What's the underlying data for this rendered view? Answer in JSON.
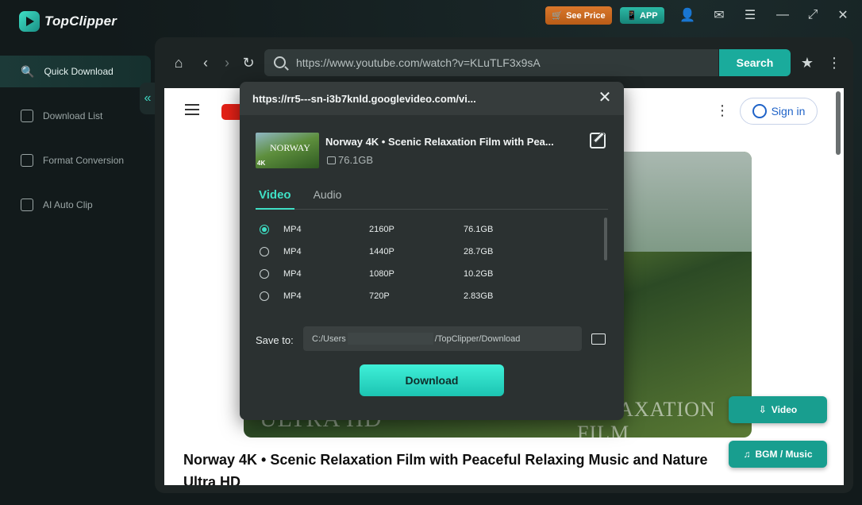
{
  "app": {
    "name": "TopClipper",
    "see_price": "See Price",
    "app_label": "APP"
  },
  "sidebar": {
    "items": [
      {
        "label": "Quick Download",
        "icon": "search-icon"
      },
      {
        "label": "Download List",
        "icon": "download-list-icon"
      },
      {
        "label": "Format Conversion",
        "icon": "format-conversion-icon"
      },
      {
        "label": "AI Auto Clip",
        "icon": "ai-clip-icon"
      }
    ]
  },
  "browser": {
    "url": "https://www.youtube.com/watch?v=KLuTLF3x9sA",
    "search_label": "Search"
  },
  "page": {
    "signin_label": "Sign in",
    "video_title": "Norway 4K • Scenic Relaxation Film with Peaceful Relaxing Music and Nature Ultra HD",
    "overlay_text_left": "ULTRA HD",
    "overlay_text_right": "RELAXATION FILM"
  },
  "floating": {
    "video_label": "Video",
    "music_label": "BGM / Music"
  },
  "modal": {
    "title": "https://rr5---sn-i3b7knld.googlevideo.com/vi...",
    "video_name": "Norway 4K • Scenic Relaxation Film with Pea...",
    "video_size": "76.1GB",
    "thumb_label": "NORWAY",
    "thumb_badge": "4K",
    "tabs": [
      "Video",
      "Audio"
    ],
    "formats": [
      {
        "format": "MP4",
        "resolution": "2160P",
        "size": "76.1GB",
        "selected": true
      },
      {
        "format": "MP4",
        "resolution": "1440P",
        "size": "28.7GB",
        "selected": false
      },
      {
        "format": "MP4",
        "resolution": "1080P",
        "size": "10.2GB",
        "selected": false
      },
      {
        "format": "MP4",
        "resolution": "720P",
        "size": "2.83GB",
        "selected": false
      }
    ],
    "save_to_label": "Save to:",
    "save_path_start": "C:/Users",
    "save_path_end": "/TopClipper/Download",
    "download_label": "Download"
  },
  "colors": {
    "accent": "#3fe0c5",
    "search_button": "#1aab9c",
    "see_price": "#d9772b"
  }
}
